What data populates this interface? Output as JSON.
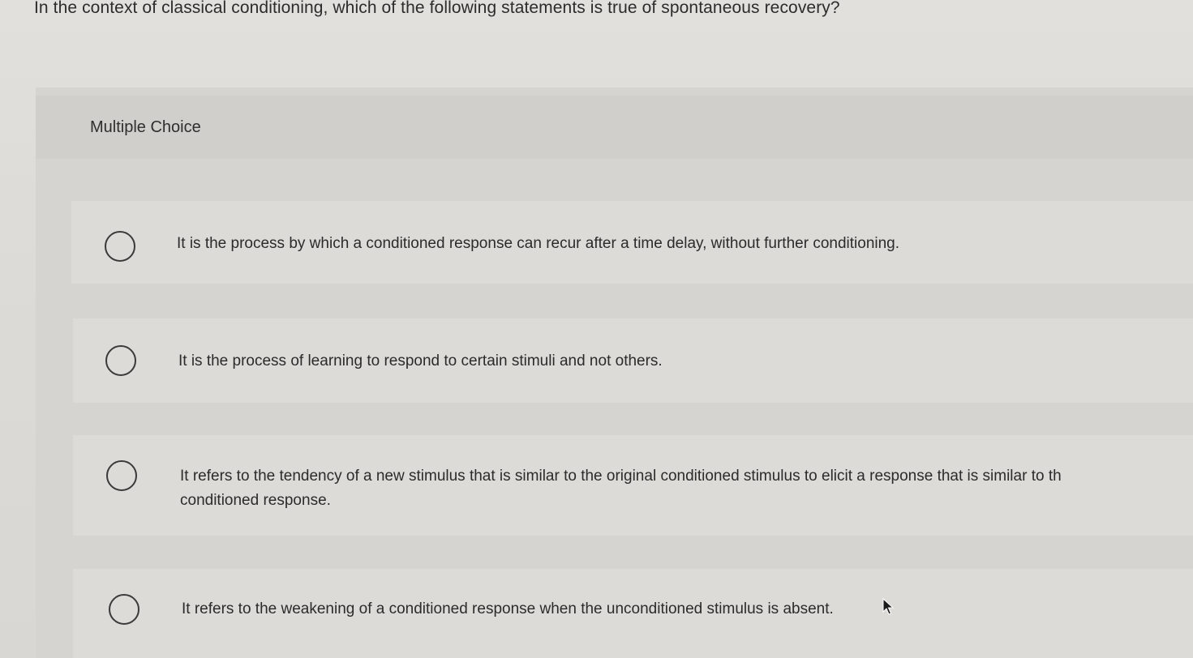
{
  "question": {
    "text": "In the context of classical conditioning, which of the following statements is true of spontaneous recovery?"
  },
  "multiple_choice": {
    "label": "Multiple Choice",
    "options": [
      {
        "line1": "It is the process by which a conditioned response can recur after a time delay, without further conditioning.",
        "line2": "",
        "selected": false
      },
      {
        "line1": "It is the process of learning to respond to certain stimuli and not others.",
        "line2": "",
        "selected": false
      },
      {
        "line1": "It refers to the tendency of a new stimulus that is similar to the original conditioned stimulus to elicit a response that is similar to th",
        "line2": "conditioned response.",
        "selected": false
      },
      {
        "line1": "It refers to the weakening of a conditioned response when the unconditioned stimulus is absent.",
        "line2": "",
        "selected": false
      }
    ]
  }
}
